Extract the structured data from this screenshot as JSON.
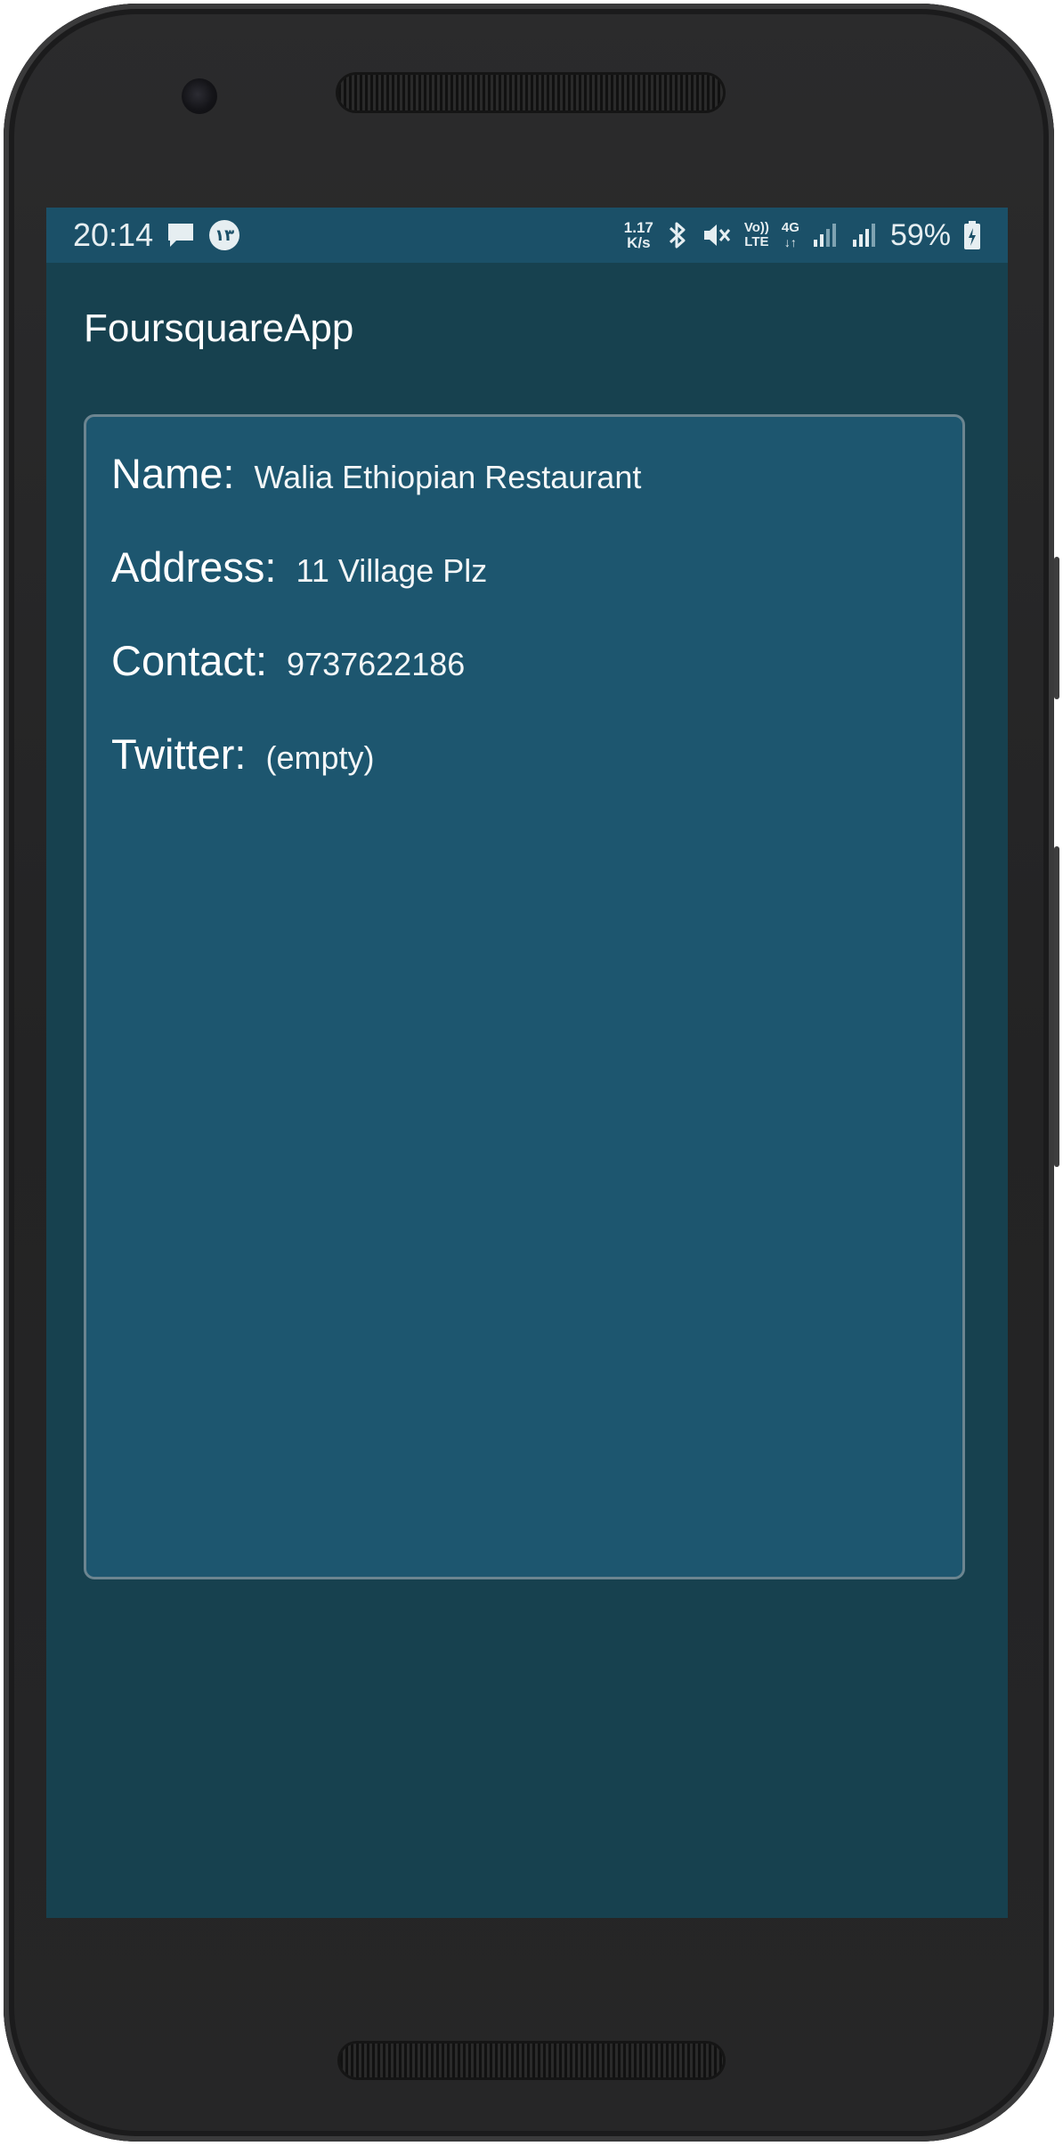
{
  "status_bar": {
    "time": "20:14",
    "net_speed_top": "1.17",
    "net_speed_bottom": "K/s",
    "notif_badge": "١٣",
    "volte_top": "Vo))",
    "volte_bottom": "LTE",
    "network": "4G",
    "battery_percent": "59%",
    "icons": [
      "message-icon",
      "app-notification-icon",
      "bluetooth-icon",
      "mute-icon",
      "volte-icon",
      "data-4g-icon",
      "signal-icon",
      "signal-icon",
      "battery-charging-icon"
    ]
  },
  "toolbar": {
    "title": "FoursquareApp"
  },
  "venue": {
    "name_label": "Name:",
    "name_value": "Walia Ethiopian Restaurant",
    "address_label": "Address:",
    "address_value": "11 Village Plz",
    "contact_label": "Contact:",
    "contact_value": "9737622186",
    "twitter_label": "Twitter:",
    "twitter_value": "(empty)"
  },
  "colors": {
    "status_bar": "#1b5068",
    "background": "#17414f",
    "card": "#1d566f",
    "card_border": "#6c8590",
    "text": "#ffffff"
  }
}
